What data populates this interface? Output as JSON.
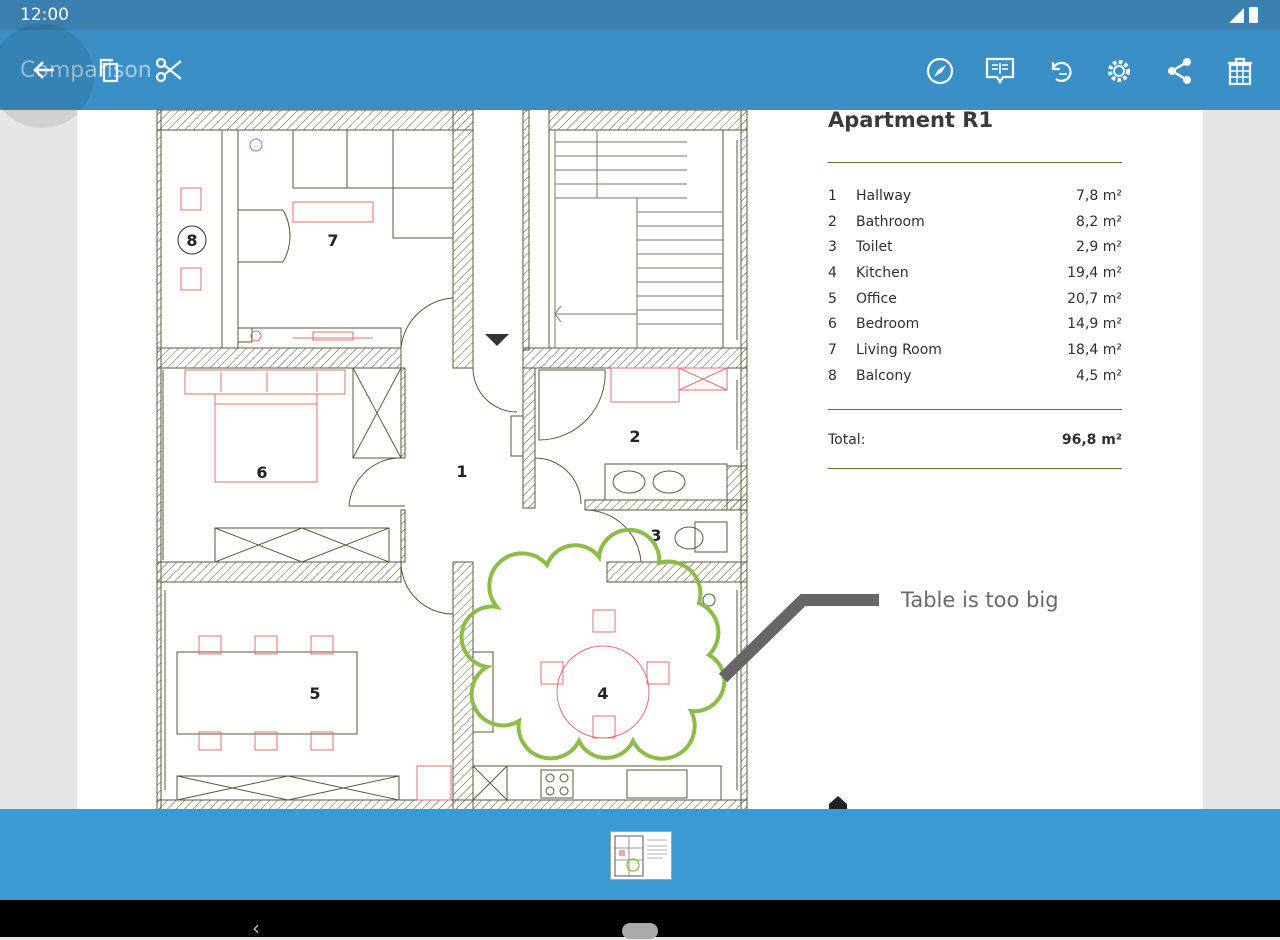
{
  "status_bar": {
    "time": "12:00"
  },
  "app_bar": {
    "title": "Comparison",
    "icons": [
      "back-arrow-icon",
      "copy-icon",
      "scissors-icon",
      "compass-icon",
      "comment-icon",
      "undo-icon",
      "settings-icon",
      "share-icon",
      "delete-icon"
    ]
  },
  "sheet": {
    "title": "Apartment R1",
    "rooms": [
      {
        "num": "1",
        "name": "Hallway",
        "area": "7,8 m²"
      },
      {
        "num": "2",
        "name": "Bathroom",
        "area": "8,2 m²"
      },
      {
        "num": "3",
        "name": "Toilet",
        "area": "2,9 m²"
      },
      {
        "num": "4",
        "name": "Kitchen",
        "area": "19,4 m²"
      },
      {
        "num": "5",
        "name": "Office",
        "area": "20,7 m²"
      },
      {
        "num": "6",
        "name": "Bedroom",
        "area": "14,9 m²"
      },
      {
        "num": "7",
        "name": "Living Room",
        "area": "18,4 m²"
      },
      {
        "num": "8",
        "name": "Balcony",
        "area": "4,5 m²"
      }
    ],
    "total_label": "Total:",
    "total_value": "96,8 m²"
  },
  "plan_labels": {
    "r1": "1",
    "r2": "2",
    "r3": "3",
    "r4": "4",
    "r5": "5",
    "r6": "6",
    "r7": "7",
    "r8": "8"
  },
  "annotation": {
    "text": "Table is too big",
    "cloud_color": "#8cbc4a",
    "leader_color": "#666666"
  },
  "colors": {
    "app_bar": "#3b8fc7",
    "status_bar": "#3a7fad",
    "bottom_bar": "#3b9ad3",
    "wall_line": "#5a5a3a",
    "furniture": "#e07070"
  }
}
